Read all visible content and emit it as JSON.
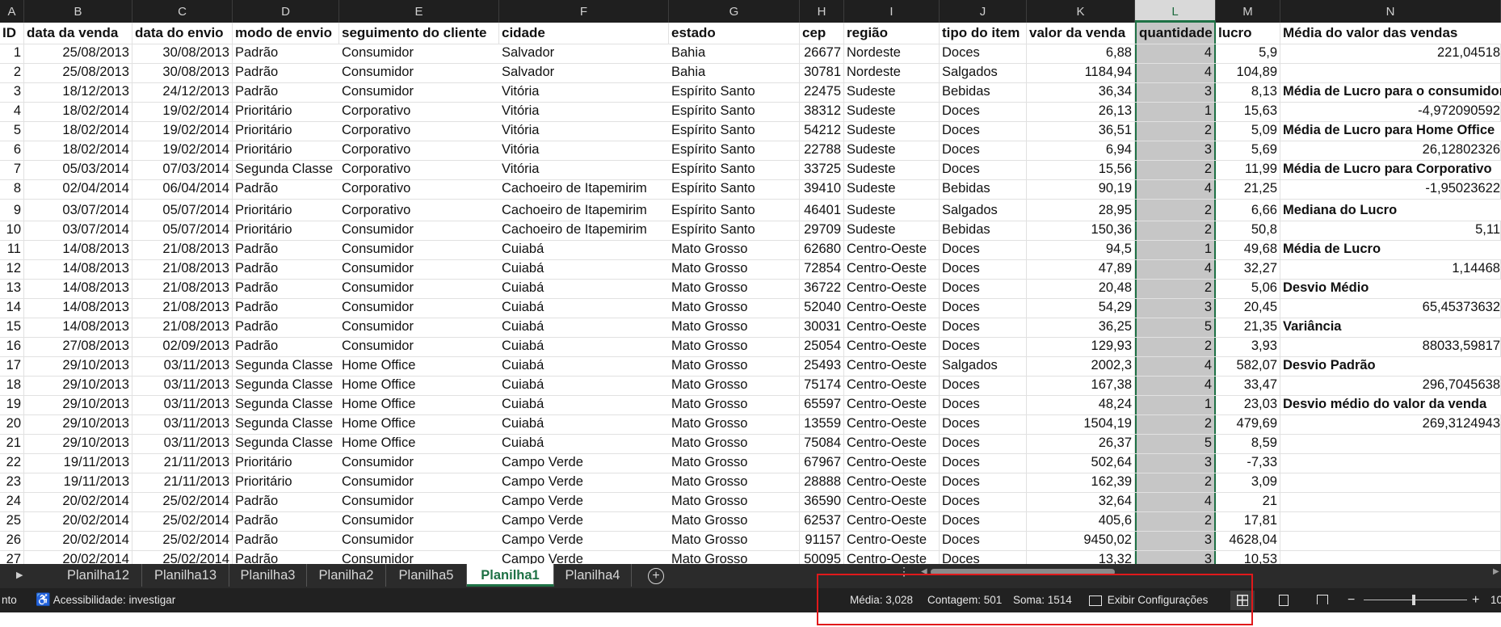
{
  "columns": [
    {
      "letter": "A"
    },
    {
      "letter": "B"
    },
    {
      "letter": "C"
    },
    {
      "letter": "D"
    },
    {
      "letter": "E"
    },
    {
      "letter": "F"
    },
    {
      "letter": "G"
    },
    {
      "letter": "H"
    },
    {
      "letter": "I"
    },
    {
      "letter": "J"
    },
    {
      "letter": "K"
    },
    {
      "letter": "L",
      "selected": true
    },
    {
      "letter": "M"
    },
    {
      "letter": "N"
    }
  ],
  "headers": [
    "ID",
    "data da venda",
    "data do envio",
    "modo de envio",
    "seguimento do cliente",
    "cidade",
    "estado",
    "cep",
    "região",
    "tipo do item",
    "valor da venda",
    "quantidade",
    "lucro",
    "Média do valor das vendas"
  ],
  "rows": [
    {
      "id": "1",
      "dv": "25/08/2013",
      "de": "30/08/2013",
      "modo": "Padrão",
      "seg": "Consumidor",
      "cidade": "Salvador",
      "estado": "Bahia",
      "cep": "26677",
      "regiao": "Nordeste",
      "tipo": "Doces",
      "valor": "6,88",
      "qtd": "4",
      "lucro": "5,9",
      "n": "221,04518",
      "nb": false
    },
    {
      "id": "2",
      "dv": "25/08/2013",
      "de": "30/08/2013",
      "modo": "Padrão",
      "seg": "Consumidor",
      "cidade": "Salvador",
      "estado": "Bahia",
      "cep": "30781",
      "regiao": "Nordeste",
      "tipo": "Salgados",
      "valor": "1184,94",
      "qtd": "4",
      "lucro": "104,89",
      "n": "",
      "nb": false
    },
    {
      "id": "3",
      "dv": "18/12/2013",
      "de": "24/12/2013",
      "modo": "Padrão",
      "seg": "Consumidor",
      "cidade": "Vitória",
      "estado": "Espírito Santo",
      "cep": "22475",
      "regiao": "Sudeste",
      "tipo": "Bebidas",
      "valor": "36,34",
      "qtd": "3",
      "lucro": "8,13",
      "n": "Média de Lucro para o consumidor",
      "nb": true
    },
    {
      "id": "4",
      "dv": "18/02/2014",
      "de": "19/02/2014",
      "modo": "Prioritário",
      "seg": "Corporativo",
      "cidade": "Vitória",
      "estado": "Espírito Santo",
      "cep": "38312",
      "regiao": "Sudeste",
      "tipo": "Doces",
      "valor": "26,13",
      "qtd": "1",
      "lucro": "15,63",
      "n": "-4,972090592",
      "nb": false
    },
    {
      "id": "5",
      "dv": "18/02/2014",
      "de": "19/02/2014",
      "modo": "Prioritário",
      "seg": "Corporativo",
      "cidade": "Vitória",
      "estado": "Espírito Santo",
      "cep": "54212",
      "regiao": "Sudeste",
      "tipo": "Doces",
      "valor": "36,51",
      "qtd": "2",
      "lucro": "5,09",
      "n": "Média de Lucro para Home Office",
      "nb": true
    },
    {
      "id": "6",
      "dv": "18/02/2014",
      "de": "19/02/2014",
      "modo": "Prioritário",
      "seg": "Corporativo",
      "cidade": "Vitória",
      "estado": "Espírito Santo",
      "cep": "22788",
      "regiao": "Sudeste",
      "tipo": "Doces",
      "valor": "6,94",
      "qtd": "3",
      "lucro": "5,69",
      "n": "26,12802326",
      "nb": false
    },
    {
      "id": "7",
      "dv": "05/03/2014",
      "de": "07/03/2014",
      "modo": "Segunda Classe",
      "seg": "Corporativo",
      "cidade": "Vitória",
      "estado": "Espírito Santo",
      "cep": "33725",
      "regiao": "Sudeste",
      "tipo": "Doces",
      "valor": "15,56",
      "qtd": "2",
      "lucro": "11,99",
      "n": "Média de Lucro para Corporativo",
      "nb": true
    },
    {
      "id": "8",
      "dv": "02/04/2014",
      "de": "06/04/2014",
      "modo": "Padrão",
      "seg": "Corporativo",
      "cidade": "Cachoeiro de Itapemirim",
      "estado": "Espírito Santo",
      "cep": "39410",
      "regiao": "Sudeste",
      "tipo": "Bebidas",
      "valor": "90,19",
      "qtd": "4",
      "lucro": "21,25",
      "n": "-1,95023622",
      "nb": false
    },
    {
      "id": "9",
      "dv": "03/07/2014",
      "de": "05/07/2014",
      "modo": "Prioritário",
      "seg": "Corporativo",
      "cidade": "Cachoeiro de Itapemirim",
      "estado": "Espírito Santo",
      "cep": "46401",
      "regiao": "Sudeste",
      "tipo": "Salgados",
      "valor": "28,95",
      "qtd": "2",
      "lucro": "6,66",
      "n": "Mediana do Lucro",
      "nb": true
    },
    {
      "id": "10",
      "dv": "03/07/2014",
      "de": "05/07/2014",
      "modo": "Prioritário",
      "seg": "Consumidor",
      "cidade": "Cachoeiro de Itapemirim",
      "estado": "Espírito Santo",
      "cep": "29709",
      "regiao": "Sudeste",
      "tipo": "Bebidas",
      "valor": "150,36",
      "qtd": "2",
      "lucro": "50,8",
      "n": "5,11",
      "nb": false
    },
    {
      "id": "11",
      "dv": "14/08/2013",
      "de": "21/08/2013",
      "modo": "Padrão",
      "seg": "Consumidor",
      "cidade": "Cuiabá",
      "estado": "Mato Grosso",
      "cep": "62680",
      "regiao": "Centro-Oeste",
      "tipo": "Doces",
      "valor": "94,5",
      "qtd": "1",
      "lucro": "49,68",
      "n": "Média de Lucro",
      "nb": true
    },
    {
      "id": "12",
      "dv": "14/08/2013",
      "de": "21/08/2013",
      "modo": "Padrão",
      "seg": "Consumidor",
      "cidade": "Cuiabá",
      "estado": "Mato Grosso",
      "cep": "72854",
      "regiao": "Centro-Oeste",
      "tipo": "Doces",
      "valor": "47,89",
      "qtd": "4",
      "lucro": "32,27",
      "n": "1,14468",
      "nb": false
    },
    {
      "id": "13",
      "dv": "14/08/2013",
      "de": "21/08/2013",
      "modo": "Padrão",
      "seg": "Consumidor",
      "cidade": "Cuiabá",
      "estado": "Mato Grosso",
      "cep": "36722",
      "regiao": "Centro-Oeste",
      "tipo": "Doces",
      "valor": "20,48",
      "qtd": "2",
      "lucro": "5,06",
      "n": "Desvio Médio",
      "nb": true
    },
    {
      "id": "14",
      "dv": "14/08/2013",
      "de": "21/08/2013",
      "modo": "Padrão",
      "seg": "Consumidor",
      "cidade": "Cuiabá",
      "estado": "Mato Grosso",
      "cep": "52040",
      "regiao": "Centro-Oeste",
      "tipo": "Doces",
      "valor": "54,29",
      "qtd": "3",
      "lucro": "20,45",
      "n": "65,45373632",
      "nb": false
    },
    {
      "id": "15",
      "dv": "14/08/2013",
      "de": "21/08/2013",
      "modo": "Padrão",
      "seg": "Consumidor",
      "cidade": "Cuiabá",
      "estado": "Mato Grosso",
      "cep": "30031",
      "regiao": "Centro-Oeste",
      "tipo": "Doces",
      "valor": "36,25",
      "qtd": "5",
      "lucro": "21,35",
      "n": "Variância",
      "nb": true
    },
    {
      "id": "16",
      "dv": "27/08/2013",
      "de": "02/09/2013",
      "modo": "Padrão",
      "seg": "Consumidor",
      "cidade": "Cuiabá",
      "estado": "Mato Grosso",
      "cep": "25054",
      "regiao": "Centro-Oeste",
      "tipo": "Doces",
      "valor": "129,93",
      "qtd": "2",
      "lucro": "3,93",
      "n": "88033,59817",
      "nb": false
    },
    {
      "id": "17",
      "dv": "29/10/2013",
      "de": "03/11/2013",
      "modo": "Segunda Classe",
      "seg": "Home Office",
      "cidade": "Cuiabá",
      "estado": "Mato Grosso",
      "cep": "25493",
      "regiao": "Centro-Oeste",
      "tipo": "Salgados",
      "valor": "2002,3",
      "qtd": "4",
      "lucro": "582,07",
      "n": "Desvio Padrão",
      "nb": true
    },
    {
      "id": "18",
      "dv": "29/10/2013",
      "de": "03/11/2013",
      "modo": "Segunda Classe",
      "seg": "Home Office",
      "cidade": "Cuiabá",
      "estado": "Mato Grosso",
      "cep": "75174",
      "regiao": "Centro-Oeste",
      "tipo": "Doces",
      "valor": "167,38",
      "qtd": "4",
      "lucro": "33,47",
      "n": "296,7045638",
      "nb": false
    },
    {
      "id": "19",
      "dv": "29/10/2013",
      "de": "03/11/2013",
      "modo": "Segunda Classe",
      "seg": "Home Office",
      "cidade": "Cuiabá",
      "estado": "Mato Grosso",
      "cep": "65597",
      "regiao": "Centro-Oeste",
      "tipo": "Doces",
      "valor": "48,24",
      "qtd": "1",
      "lucro": "23,03",
      "n": "Desvio médio do valor da venda",
      "nb": true
    },
    {
      "id": "20",
      "dv": "29/10/2013",
      "de": "03/11/2013",
      "modo": "Segunda Classe",
      "seg": "Home Office",
      "cidade": "Cuiabá",
      "estado": "Mato Grosso",
      "cep": "13559",
      "regiao": "Centro-Oeste",
      "tipo": "Doces",
      "valor": "1504,19",
      "qtd": "2",
      "lucro": "479,69",
      "n": "269,3124943",
      "nb": false
    },
    {
      "id": "21",
      "dv": "29/10/2013",
      "de": "03/11/2013",
      "modo": "Segunda Classe",
      "seg": "Home Office",
      "cidade": "Cuiabá",
      "estado": "Mato Grosso",
      "cep": "75084",
      "regiao": "Centro-Oeste",
      "tipo": "Doces",
      "valor": "26,37",
      "qtd": "5",
      "lucro": "8,59",
      "n": "",
      "nb": false
    },
    {
      "id": "22",
      "dv": "19/11/2013",
      "de": "21/11/2013",
      "modo": "Prioritário",
      "seg": "Consumidor",
      "cidade": "Campo Verde",
      "estado": "Mato Grosso",
      "cep": "67967",
      "regiao": "Centro-Oeste",
      "tipo": "Doces",
      "valor": "502,64",
      "qtd": "3",
      "lucro": "-7,33",
      "n": "",
      "nb": false
    },
    {
      "id": "23",
      "dv": "19/11/2013",
      "de": "21/11/2013",
      "modo": "Prioritário",
      "seg": "Consumidor",
      "cidade": "Campo Verde",
      "estado": "Mato Grosso",
      "cep": "28888",
      "regiao": "Centro-Oeste",
      "tipo": "Doces",
      "valor": "162,39",
      "qtd": "2",
      "lucro": "3,09",
      "n": "",
      "nb": false
    },
    {
      "id": "24",
      "dv": "20/02/2014",
      "de": "25/02/2014",
      "modo": "Padrão",
      "seg": "Consumidor",
      "cidade": "Campo Verde",
      "estado": "Mato Grosso",
      "cep": "36590",
      "regiao": "Centro-Oeste",
      "tipo": "Doces",
      "valor": "32,64",
      "qtd": "4",
      "lucro": "21",
      "n": "",
      "nb": false
    },
    {
      "id": "25",
      "dv": "20/02/2014",
      "de": "25/02/2014",
      "modo": "Padrão",
      "seg": "Consumidor",
      "cidade": "Campo Verde",
      "estado": "Mato Grosso",
      "cep": "62537",
      "regiao": "Centro-Oeste",
      "tipo": "Doces",
      "valor": "405,6",
      "qtd": "2",
      "lucro": "17,81",
      "n": "",
      "nb": false
    },
    {
      "id": "26",
      "dv": "20/02/2014",
      "de": "25/02/2014",
      "modo": "Padrão",
      "seg": "Consumidor",
      "cidade": "Campo Verde",
      "estado": "Mato Grosso",
      "cep": "91157",
      "regiao": "Centro-Oeste",
      "tipo": "Doces",
      "valor": "9450,02",
      "qtd": "3",
      "lucro": "4628,04",
      "n": "",
      "nb": false
    },
    {
      "id": "27",
      "dv": "20/02/2014",
      "de": "25/02/2014",
      "modo": "Padrão",
      "seg": "Consumidor",
      "cidade": "Campo Verde",
      "estado": "Mato Grosso",
      "cep": "50095",
      "regiao": "Centro-Oeste",
      "tipo": "Doces",
      "valor": "13,32",
      "qtd": "3",
      "lucro": "10,53",
      "n": "",
      "nb": false
    }
  ],
  "tabs": [
    "Planilha12",
    "Planilha13",
    "Planilha3",
    "Planilha2",
    "Planilha5",
    "Planilha1",
    "Planilha4"
  ],
  "active_tab": "Planilha1",
  "status": {
    "left_cut": "nto",
    "accessibility": "Acessibilidade: investigar",
    "media": "Média: 3,028",
    "contagem": "Contagem: 501",
    "soma": "Soma: 1514",
    "exibir": "Exibir Configurações",
    "zoom_cut": "10",
    "zoom_minus": "−",
    "zoom_plus": "+"
  },
  "colors": {
    "accent": "#1e7145",
    "highlight": "#e0191b",
    "selected_cell": "#c6c6c6"
  }
}
